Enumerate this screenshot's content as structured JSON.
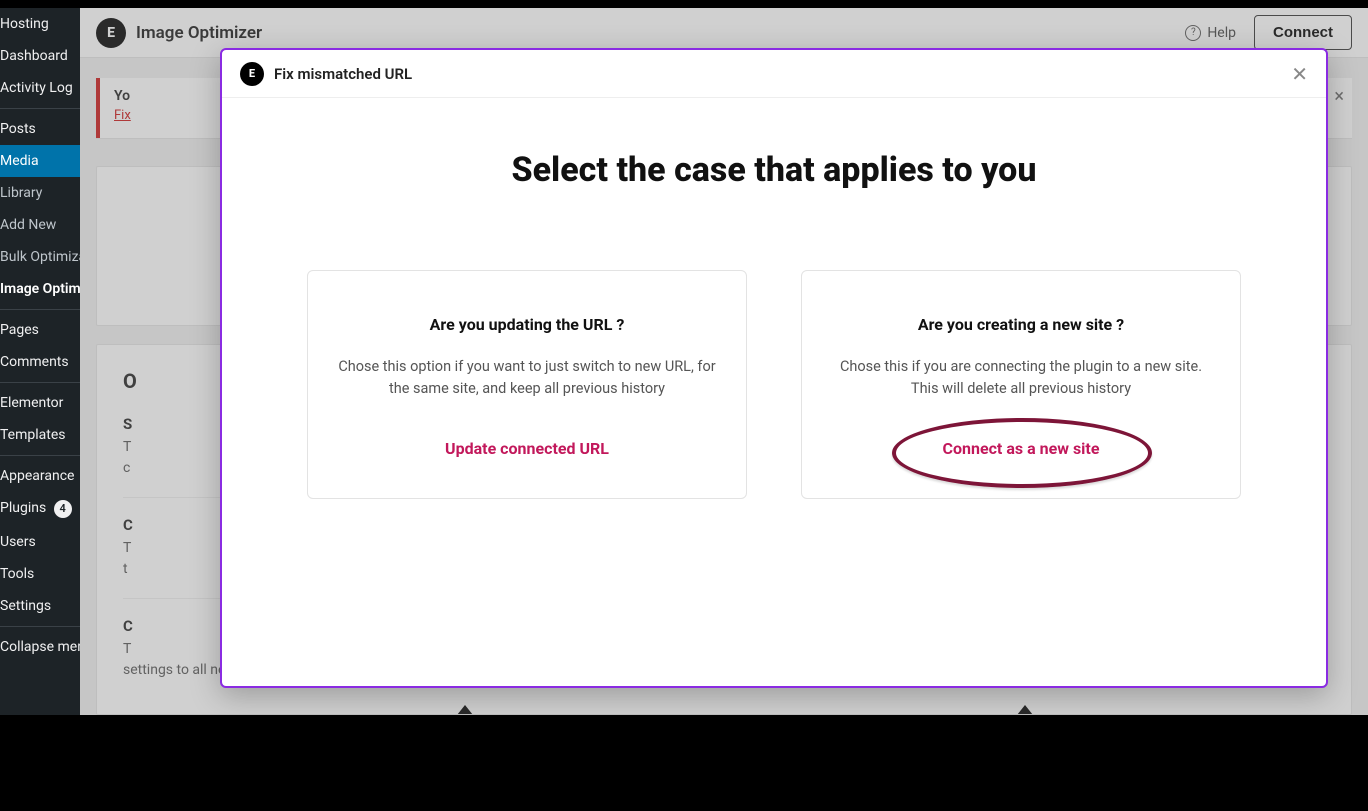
{
  "sidebar": {
    "items": [
      {
        "label": "Hosting"
      },
      {
        "label": "Dashboard"
      },
      {
        "label": "Activity Log"
      },
      {
        "label": "Posts"
      },
      {
        "label": "Media"
      },
      {
        "label": "Library"
      },
      {
        "label": "Add New"
      },
      {
        "label": "Bulk Optimization"
      },
      {
        "label": "Image Optimizer"
      },
      {
        "label": "Pages"
      },
      {
        "label": "Comments"
      },
      {
        "label": "Elementor"
      },
      {
        "label": "Templates"
      },
      {
        "label": "Appearance"
      },
      {
        "label": "Plugins"
      },
      {
        "label": "Users"
      },
      {
        "label": "Tools"
      },
      {
        "label": "Settings"
      },
      {
        "label": "Collapse menu"
      }
    ],
    "plugins_badge": "4"
  },
  "topbar": {
    "title": "Image Optimizer",
    "help": "Help",
    "connect": "Connect"
  },
  "notice": {
    "title": "Yo",
    "link": "Fix"
  },
  "settings": {
    "heading": "O",
    "row1_title": "S",
    "row1_desc_a": "T",
    "row1_desc_b": "c",
    "row2_title": "C",
    "row2_desc_a": "T",
    "row2_desc_b": "t",
    "row3_title": "C",
    "row3_desc_a": "T",
    "row3_desc_b": "settings to all new uploads."
  },
  "modal": {
    "header": "Fix mismatched URL",
    "heading": "Select the case that applies to you",
    "card1": {
      "question": "Are you updating the URL ?",
      "desc": "Chose this option if you want to just switch to new URL, for the same site, and keep all previous history",
      "action": "Update connected URL"
    },
    "card2": {
      "question": "Are you creating a new site ?",
      "desc": "Chose this if you are connecting the plugin to a  new site. This will delete all previous history",
      "action": "Connect as a new site"
    }
  }
}
